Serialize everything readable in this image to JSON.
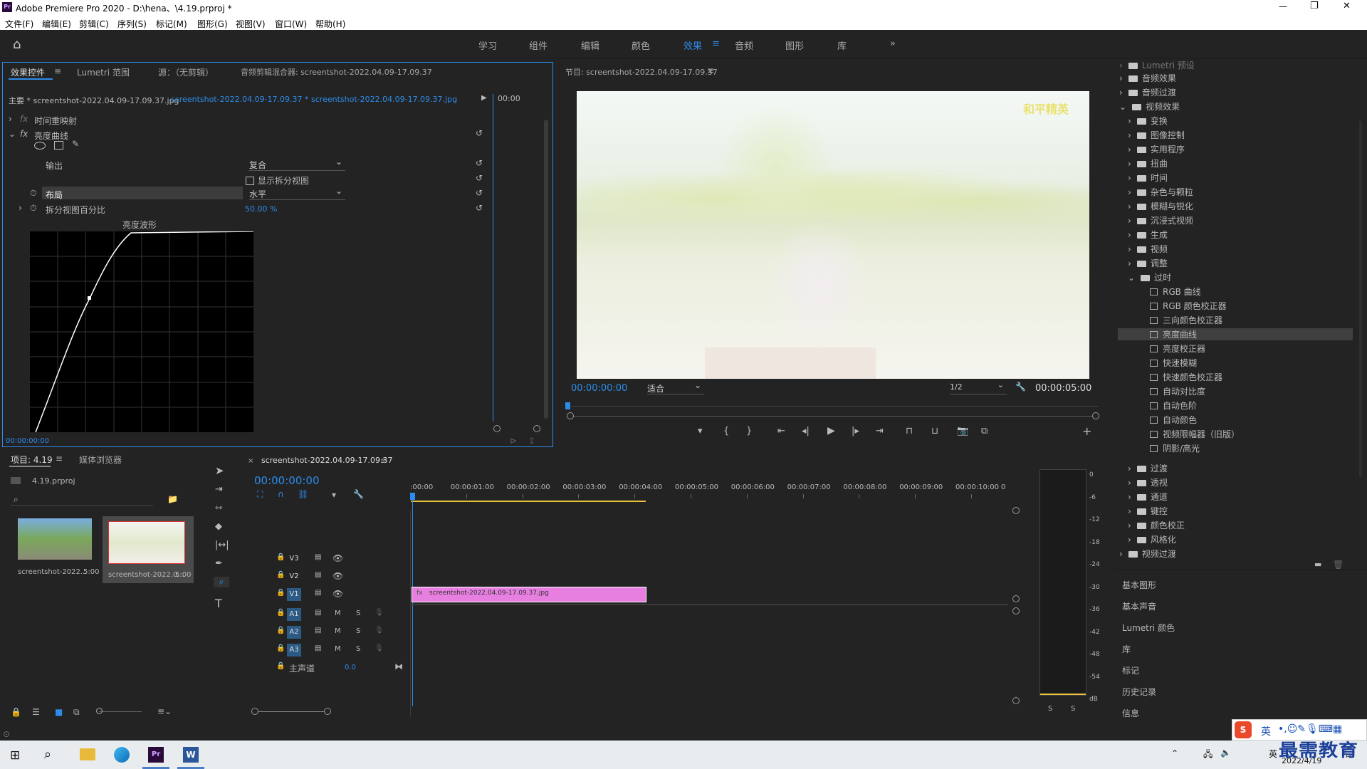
{
  "window": {
    "title": "Adobe Premiere Pro 2020 - D:\\hena、\\4.19.prproj *",
    "app_icon": "Pr",
    "controls": [
      "—",
      "❐",
      "✕"
    ]
  },
  "menu": [
    "文件(F)",
    "编辑(E)",
    "剪辑(C)",
    "序列(S)",
    "标记(M)",
    "图形(G)",
    "视图(V)",
    "窗口(W)",
    "帮助(H)"
  ],
  "workspaces": [
    "学习",
    "组件",
    "编辑",
    "颜色",
    "效果",
    "音频",
    "图形",
    "库"
  ],
  "workspace_active": "效果",
  "effect_controls": {
    "tabs": [
      "效果控件",
      "Lumetri 范围",
      "源：（无剪辑）",
      "音频剪辑混合器: screentshot-2022.04.09-17.09.37"
    ],
    "master_label": "主要 * screentshot-2022.04.09-17.09.37.jpg",
    "clip_label": "screentshot-2022.04.09-17.09.37 * screentshot-2022.04.09-17.09.37.jpg",
    "timecode_right": "00:00",
    "time_remap": "时间重映射",
    "luma_curve": "亮度曲线",
    "output_label": "输出",
    "output_value": "复合",
    "split_view_label": "显示拆分视图",
    "layout_label": "布局",
    "layout_value": "水平",
    "split_pct_label": "拆分视图百分比",
    "split_pct_value": "50.00 %",
    "waveform_label": "亮度波形",
    "timecode_bottom": "00:00:00:00"
  },
  "program": {
    "title": "节目: screentshot-2022.04.09-17.09.37",
    "timecode": "00:00:00:00",
    "fit": "适合",
    "quality": "1/2",
    "duration": "00:00:05:00",
    "overlay_logo": "和平精英"
  },
  "effects_tree": {
    "top_items": [
      "Lumetri 预设",
      "音频效果",
      "音频过渡",
      "视频效果"
    ],
    "video_effects": [
      "变换",
      "图像控制",
      "实用程序",
      "扭曲",
      "时间",
      "杂色与颗粒",
      "模糊与锐化",
      "沉浸式视频",
      "生成",
      "视频",
      "调整",
      "过时"
    ],
    "obsolete": [
      "RGB 曲线",
      "RGB 颜色校正器",
      "三向颜色校正器",
      "亮度曲线",
      "亮度校正器",
      "快速模糊",
      "快速颜色校正器",
      "自动对比度",
      "自动色阶",
      "自动颜色",
      "视频限幅器（旧版）",
      "阴影/高光"
    ],
    "obsolete_selected": "亮度曲线",
    "after": [
      "过渡",
      "透视",
      "通道",
      "键控",
      "颜色校正",
      "风格化"
    ],
    "last": "视频过渡"
  },
  "side_panels": [
    "基本图形",
    "基本声音",
    "Lumetri 颜色",
    "库",
    "标记",
    "历史记录",
    "信息"
  ],
  "project": {
    "tabs": [
      "项目: 4.19",
      "媒体浏览器"
    ],
    "file": "4.19.prproj",
    "items": [
      {
        "name": "screentshot-2022...",
        "dur": "5:00"
      },
      {
        "name": "screentshot-2022.0...",
        "dur": "5:00"
      }
    ]
  },
  "timeline": {
    "tab": "screentshot-2022.04.09-17.09.37",
    "timecode": "00:00:00:00",
    "ruler": [
      ":00:00",
      "00:00:01:00",
      "00:00:02:00",
      "00:00:03:00",
      "00:00:04:00",
      "00:00:05:00",
      "00:00:06:00",
      "00:00:07:00",
      "00:00:08:00",
      "00:00:09:00",
      "00:00:10:00",
      "0"
    ],
    "video_tracks": [
      "V3",
      "V2",
      "V1"
    ],
    "audio_tracks": [
      "A1",
      "A2",
      "A3"
    ],
    "master": "主声道",
    "master_value": "0.0",
    "clip": "screentshot-2022.04.09-17.09.37.jpg",
    "m": "M",
    "s": "S"
  },
  "meter": {
    "scale": [
      "0",
      "-6",
      "-12",
      "-18",
      "-24",
      "-30",
      "-36",
      "-42",
      "-48",
      "-54",
      "dB"
    ],
    "s": "S"
  },
  "taskbar": {
    "date": "2022/4/19",
    "ime": "英",
    "watermark": "最需教育"
  },
  "colors": {
    "accent": "#2d8ceb",
    "clip": "#e67fe0",
    "panel": "#232323"
  }
}
